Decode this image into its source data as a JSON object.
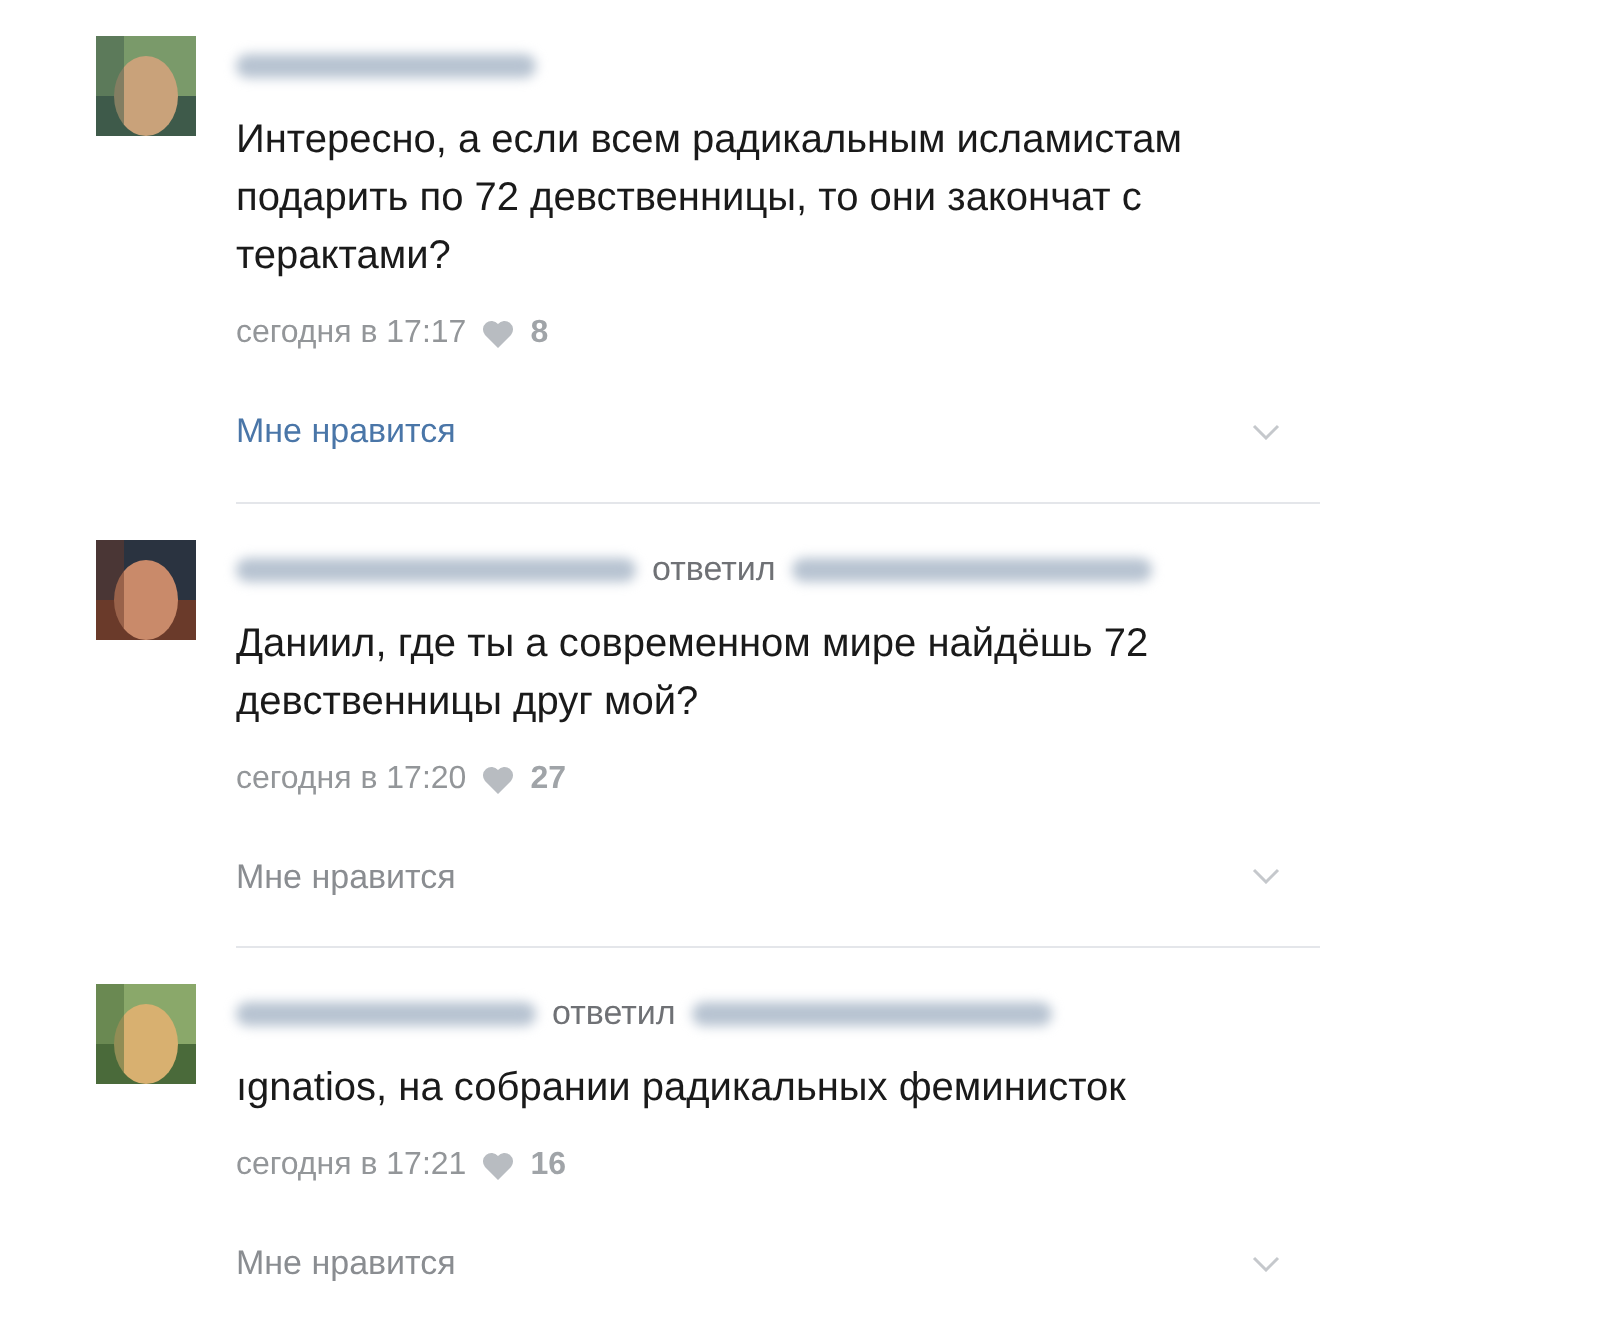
{
  "comments": [
    {
      "text": "Интересно, а если всем радикальным исламистам подарить по 72 девственницы, то они закончат с терактами?",
      "date": "сегодня в 17:17",
      "likes": "8",
      "like_label": "Мне нравится",
      "highlighted": true
    },
    {
      "reply_word": "ответил",
      "text": "Даниил, где ты а современном мире найдёшь 72 девственницы друг мой?",
      "date": "сегодня в 17:20",
      "likes": "27",
      "like_label": "Мне нравится",
      "highlighted": false
    },
    {
      "reply_word": "ответил",
      "text": "ıgnatios, на собрании радикальных феминисток",
      "date": "сегодня в 17:21",
      "likes": "16",
      "like_label": "Мне нравится",
      "highlighted": false
    }
  ]
}
